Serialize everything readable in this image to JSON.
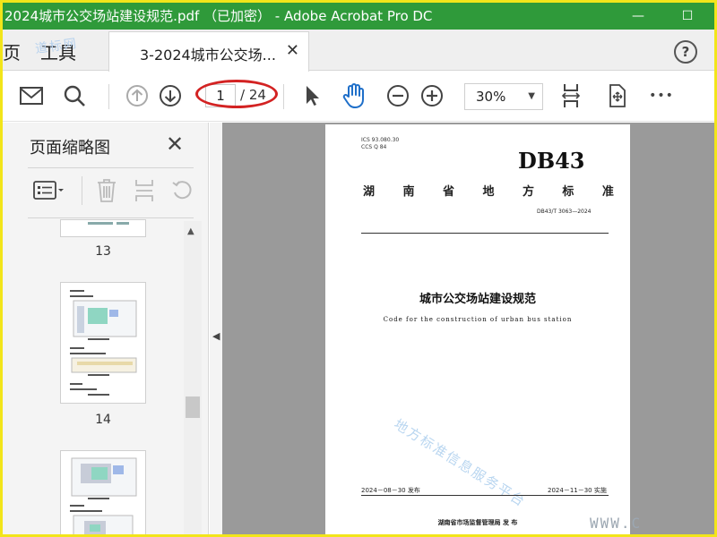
{
  "window": {
    "title": "2024城市公交场站建设规范.pdf （已加密） - Adobe Acrobat Pro DC",
    "minimize": "—",
    "maximize": "☐"
  },
  "tabs": {
    "cut_label": "页",
    "tools_label": "工具",
    "doc_label": "3-2024城市公交场...",
    "close": "✕",
    "help": "?"
  },
  "toolbar": {
    "current_page": "1",
    "total_pages": "/ 24",
    "zoom": "30%",
    "more": "•••"
  },
  "sidebar": {
    "title": "页面缩略图",
    "close": "✕",
    "thumbnails": [
      {
        "number": "13"
      },
      {
        "number": "14"
      }
    ]
  },
  "page": {
    "ics": "ICS 93.080.30",
    "ccs": "CCS Q 84",
    "db_mark": "DB43",
    "province": [
      "湖",
      "南",
      "省",
      "地",
      "方",
      "标",
      "准"
    ],
    "code": "DB43/T 3063—2024",
    "title": "城市公交场站建设规范",
    "title_en": "Code for the construction of urban bus station",
    "watermark": "地方标准信息服务平台",
    "issue_date": "2024－08－30 发布",
    "impl_date": "2024－11－30 实施",
    "publisher": "湖南省市场监督管理局    发 布"
  },
  "overlays": {
    "top_watermark": "道标网",
    "site_watermark": "WWW.C"
  },
  "colors": {
    "titlebar": "#2f9a3a",
    "highlight_circle": "#d32222",
    "frame": "#f2e51a"
  }
}
